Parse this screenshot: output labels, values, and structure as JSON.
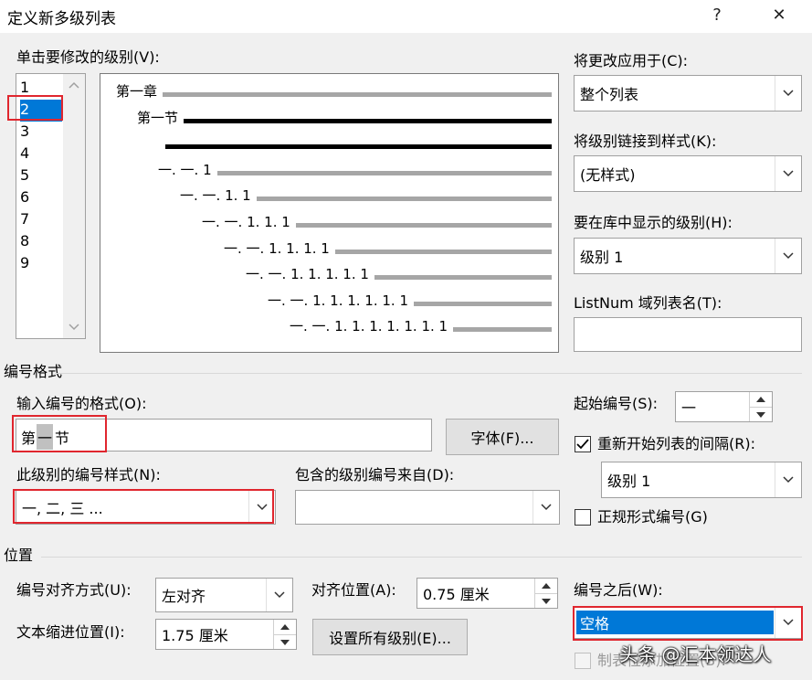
{
  "window": {
    "title": "定义新多级列表",
    "help": "?",
    "close": "✕"
  },
  "level_list": {
    "label": "单击要修改的级别(V):",
    "items": [
      "1",
      "2",
      "3",
      "4",
      "5",
      "6",
      "7",
      "8",
      "9"
    ],
    "selected_index": 1
  },
  "preview": {
    "rows": [
      "第一章",
      "第一节",
      "",
      "一. 一. 1",
      "一. 一. 1. 1",
      "一. 一. 1. 1. 1",
      "一. 一. 1. 1. 1. 1",
      "一. 一. 1. 1. 1. 1. 1",
      "一. 一. 1. 1. 1. 1. 1. 1",
      "一. 一. 1. 1. 1. 1. 1. 1. 1"
    ]
  },
  "apply_to": {
    "label": "将更改应用于(C):",
    "value": "整个列表"
  },
  "link_style": {
    "label": "将级别链接到样式(K):",
    "value": "(无样式)"
  },
  "gallery_level": {
    "label": "要在库中显示的级别(H):",
    "value": "级别 1"
  },
  "listnum": {
    "label": "ListNum 域列表名(T):",
    "value": ""
  },
  "number_format": {
    "section": "编号格式",
    "input_label": "输入编号的格式(O):",
    "format_prefix": "第",
    "format_field": "一",
    "format_suffix": "节",
    "font_button": "字体(F)...",
    "style_label": "此级别的编号样式(N):",
    "style_value": "一, 二, 三 ...",
    "include_label": "包含的级别编号来自(D):",
    "include_value": "",
    "start_label": "起始编号(S):",
    "start_value": "一",
    "restart_label": "重新开始列表的间隔(R):",
    "restart_checked": true,
    "restart_value": "级别 1",
    "legal_label": "正规形式编号(G)",
    "legal_checked": false
  },
  "position": {
    "section": "位置",
    "align_label": "编号对齐方式(U):",
    "align_value": "左对齐",
    "align_at_label": "对齐位置(A):",
    "align_at_value": "0.75 厘米",
    "indent_label": "文本缩进位置(I):",
    "indent_value": "1.75 厘米",
    "set_all_button": "设置所有级别(E)...",
    "follow_label": "编号之后(W):",
    "follow_value": "空格",
    "tab_stop_label": "制表位添加位置(B):"
  },
  "watermark": "头条 @汇本领达人",
  "colors": {
    "selection": "#0078d7",
    "highlight_border": "#e0262e",
    "preview_gray": "#a6a6a6",
    "preview_black": "#000000"
  }
}
